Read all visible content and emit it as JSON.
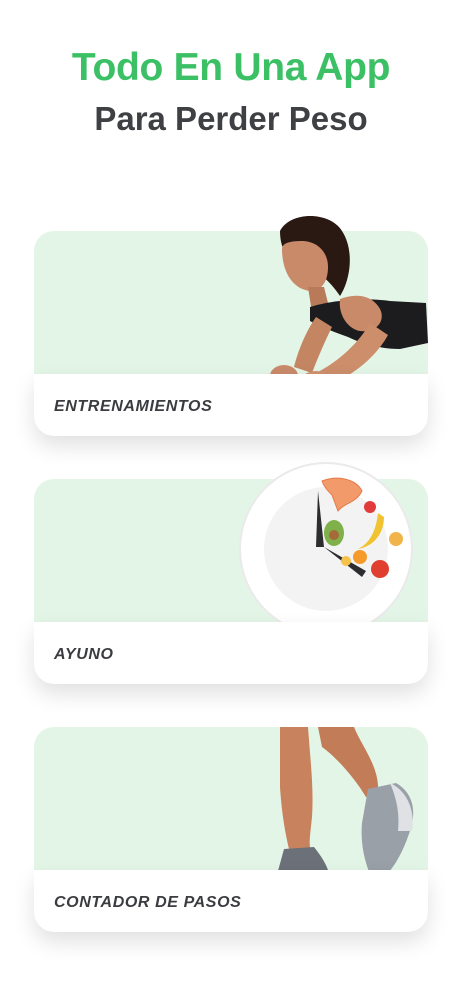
{
  "header": {
    "title_line1": "Todo En Una App",
    "title_line2": "Para Perder Peso",
    "accent_color": "#3cc065",
    "text_color": "#3f4044"
  },
  "cards": [
    {
      "label": "ENTRENAMIENTOS",
      "illustration": "woman-plank-illustration"
    },
    {
      "label": "AYUNO",
      "illustration": "fasting-plate-clock-illustration"
    },
    {
      "label": "CONTADOR DE PASOS",
      "illustration": "walking-legs-sneakers-illustration"
    }
  ],
  "colors": {
    "card_bg": "#e3f5e6",
    "card_bar": "#ffffff"
  }
}
